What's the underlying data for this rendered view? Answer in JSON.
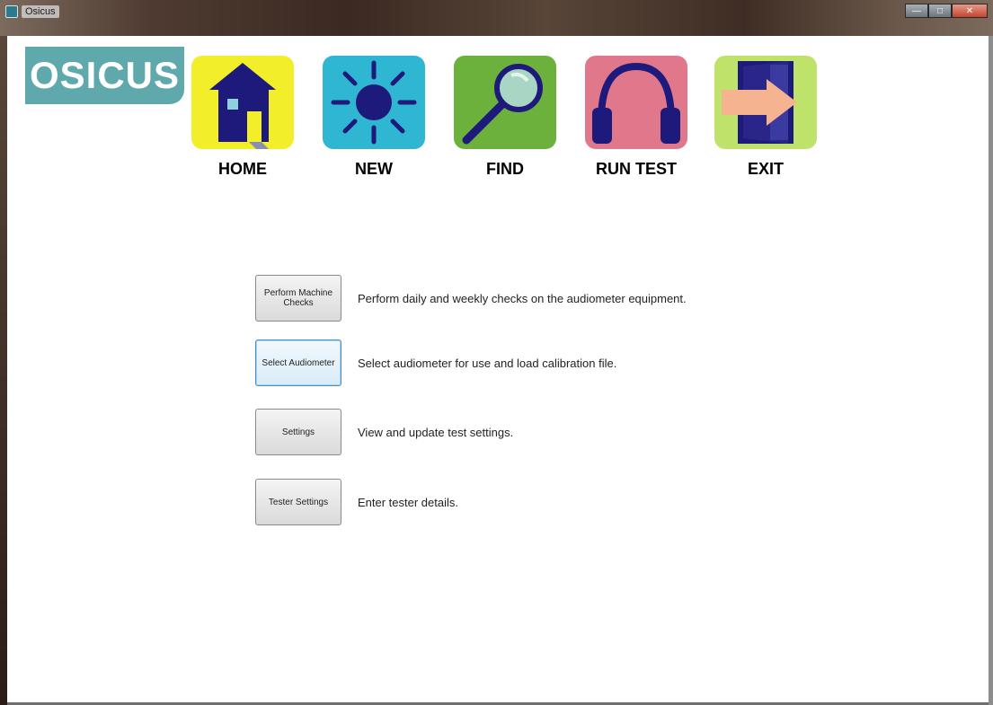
{
  "window": {
    "title": "Osicus",
    "buttons": [
      "minimize",
      "maximize",
      "close"
    ]
  },
  "logo": {
    "text": "OSICUS"
  },
  "nav": [
    {
      "id": "home",
      "label": "HOME",
      "icon": "house-icon",
      "bg": "#f2ef2a"
    },
    {
      "id": "new",
      "label": "NEW",
      "icon": "sun-icon",
      "bg": "#2fb6d2"
    },
    {
      "id": "find",
      "label": "FIND",
      "icon": "magnifier-icon",
      "bg": "#6cb13b"
    },
    {
      "id": "run-test",
      "label": "RUN TEST",
      "icon": "headphones-icon",
      "bg": "#e0778a"
    },
    {
      "id": "exit",
      "label": "EXIT",
      "icon": "door-exit-icon",
      "bg": "#bfe36a"
    }
  ],
  "actions": [
    {
      "button": "Perform Machine Checks",
      "description": "Perform daily and weekly checks on the audiometer equipment."
    },
    {
      "button": "Select Audiometer",
      "description": "Select audiometer for use and load calibration file."
    },
    {
      "button": "Settings",
      "description": "View and update test settings."
    },
    {
      "button": "Tester Settings",
      "description": "Enter tester details."
    }
  ],
  "colors": {
    "logo_bg": "#5fa9ad",
    "nav_icon_fg": "#1e1a7c",
    "focus_border": "#4a90c2"
  }
}
